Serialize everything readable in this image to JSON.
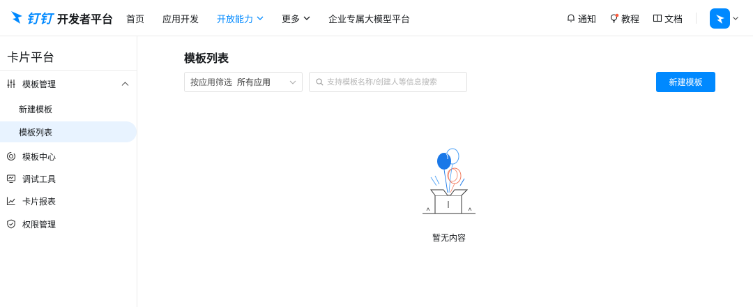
{
  "header": {
    "brand": "钉钉",
    "subtitle": "开发者平台",
    "nav": [
      {
        "label": "首页"
      },
      {
        "label": "应用开发"
      },
      {
        "label": "开放能力"
      },
      {
        "label": "更多"
      },
      {
        "label": "企业专属大模型平台"
      }
    ],
    "right": {
      "notify": "通知",
      "tutorial": "教程",
      "docs": "文档"
    },
    "colors": {
      "accent": "#0089ff",
      "badge": "#ff5a3c"
    }
  },
  "sidebar": {
    "title": "卡片平台",
    "groups": [
      {
        "label": "模板管理",
        "icon": "sliders-icon",
        "children": [
          {
            "label": "新建模板"
          },
          {
            "label": "模板列表"
          }
        ]
      },
      {
        "label": "模板中心",
        "icon": "target-icon"
      },
      {
        "label": "调试工具",
        "icon": "monitor-icon"
      },
      {
        "label": "卡片报表",
        "icon": "chart-line-icon"
      },
      {
        "label": "权限管理",
        "icon": "shield-icon"
      }
    ]
  },
  "main": {
    "title": "模板列表",
    "filter": {
      "label": "按应用筛选",
      "value": "所有应用"
    },
    "search": {
      "placeholder": "支持模板名称/创建人等信息搜索",
      "value": ""
    },
    "new_button": "新建模板",
    "empty_text": "暂无内容"
  }
}
